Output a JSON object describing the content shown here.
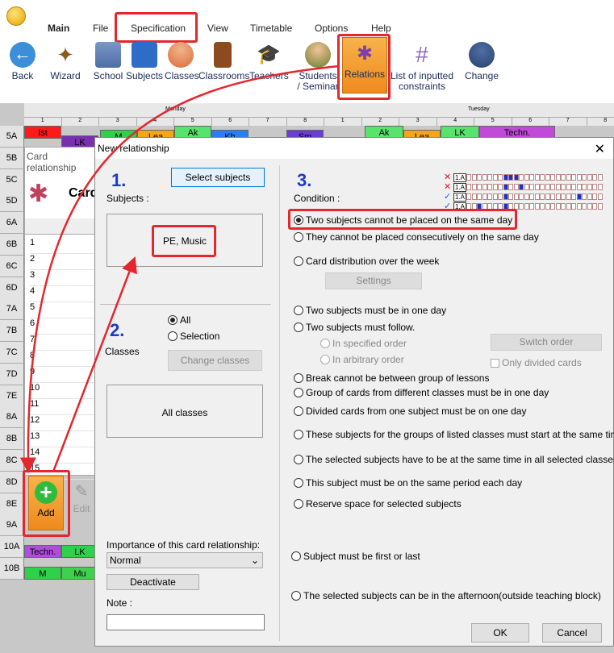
{
  "ribbon": {
    "tabs": [
      "Main",
      "File",
      "Specification",
      "View",
      "Timetable",
      "Options",
      "Help"
    ],
    "buttons": [
      "Back",
      "Wizard",
      "School",
      "Subjects",
      "Classes",
      "Classrooms",
      "Teachers",
      "Students / Seminar",
      "Relations",
      "List of inputted constraints",
      "Change"
    ]
  },
  "grid": {
    "rows": [
      "5A",
      "5B",
      "5C",
      "5D",
      "6A",
      "6B",
      "6C",
      "6D",
      "7A",
      "7B",
      "7C",
      "7D",
      "7E",
      "8A",
      "8B",
      "8C",
      "8D",
      "8E",
      "9A",
      "10A",
      "10B"
    ],
    "day_headers": [
      "Monday",
      "Tuesday"
    ],
    "period_numbers": [
      "1",
      "2",
      "3",
      "4",
      "5",
      "6",
      "7",
      "8"
    ],
    "top_row_cells": [
      "Ist",
      "LK",
      "M",
      "Lea",
      "Ak",
      "Kh",
      "Sm",
      "Ak",
      "Lea",
      "LK",
      "Techn."
    ],
    "row_10a": [
      "Techn.",
      "LK"
    ],
    "row_10b": [
      "M",
      "Mu"
    ],
    "list_numbers": [
      "1",
      "2",
      "3",
      "4",
      "5",
      "6",
      "7",
      "8",
      "9",
      "10",
      "11",
      "12",
      "13",
      "14",
      "15"
    ]
  },
  "card_panel": {
    "title": "Card relationship",
    "heading": "Card",
    "add_label": "Add",
    "edit_label": "Edit"
  },
  "dialog": {
    "title": "New relationship",
    "close": "✕",
    "step1": "1.",
    "step2": "2.",
    "step3": "3.",
    "select_subjects": "Select subjects",
    "subjects_label": "Subjects :",
    "subjects_value": "PE, Music",
    "classes_label": "Classes",
    "classes_all": "All",
    "classes_selection": "Selection",
    "change_classes": "Change classes",
    "classes_value": "All classes",
    "importance_label": "Importance of this card relationship:",
    "importance_value": "Normal",
    "deactivate": "Deactivate",
    "note_label": "Note :",
    "condition_label": "Condition :",
    "conditions": [
      "Two subjects cannot be placed on the same day",
      "They cannot be placed consecutively on the same day",
      "Card distribution over the week",
      "Two subjects must be in one day",
      "Two subjects must follow.",
      "Break cannot be between group of lessons",
      "Group of cards from different classes must be in one day",
      "Divided cards from one subject must be on one day",
      "These subjects for the groups of listed classes must start at the same time.",
      "The selected subjects have to be at the same time in all selected classes.",
      "This subject must be on the same period each day",
      "Reserve space for selected subjects",
      "Subject must be first or last",
      "The selected subjects can be in the afternoon(outside teaching block)"
    ],
    "settings": "Settings",
    "specified_order": "In specified order",
    "arbitrary_order": "In arbitrary order",
    "switch_order": "Switch order",
    "only_divided": "Only divided cards",
    "preview_label": "1.A",
    "ok": "OK",
    "cancel": "Cancel"
  }
}
